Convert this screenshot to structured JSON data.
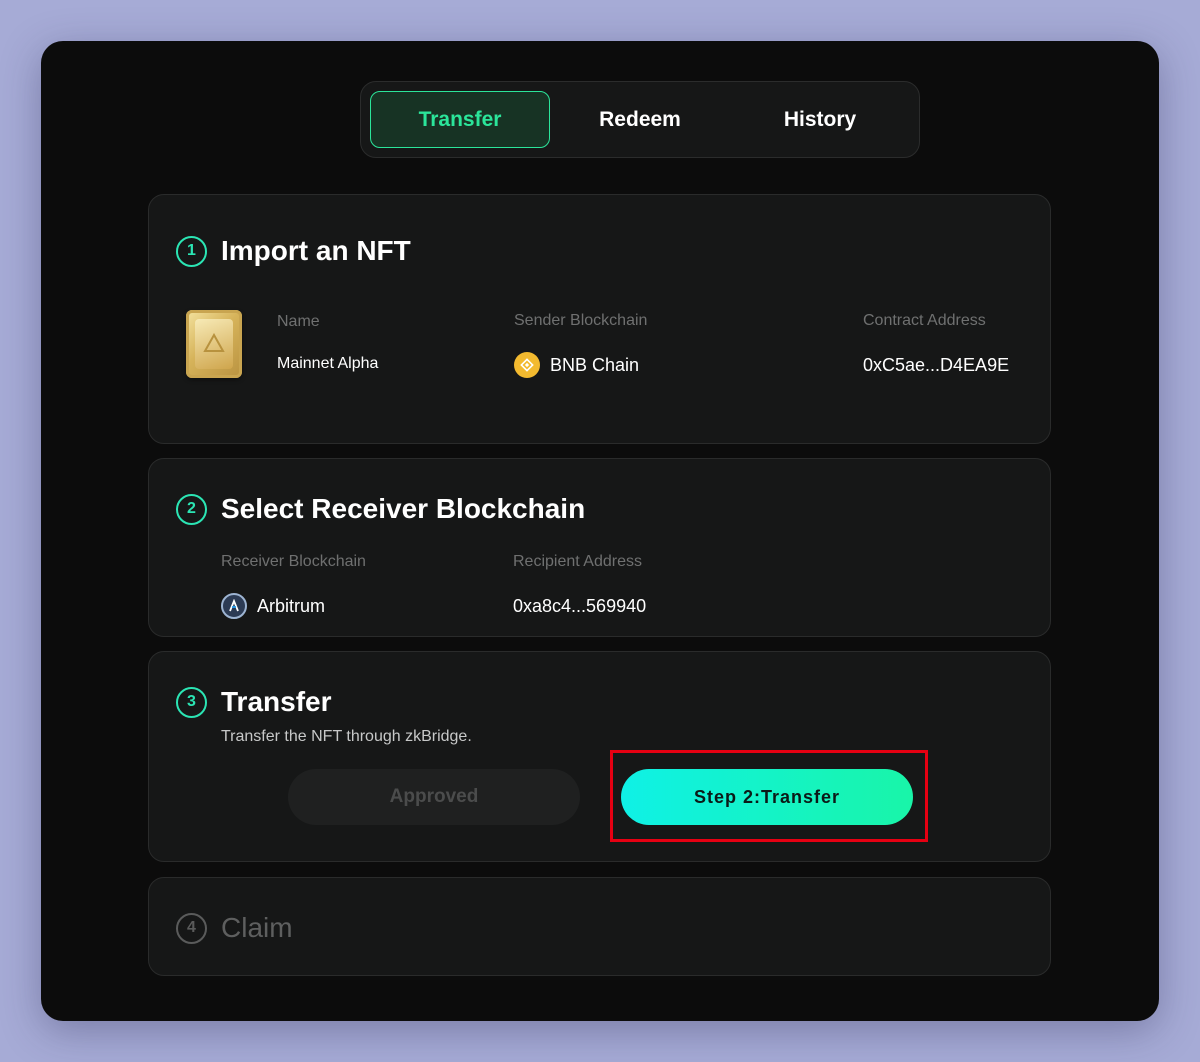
{
  "tabs": [
    {
      "label": "Transfer",
      "active": true
    },
    {
      "label": "Redeem",
      "active": false
    },
    {
      "label": "History",
      "active": false
    }
  ],
  "step1": {
    "number": "1",
    "title": "Import an NFT",
    "name_label": "Name",
    "name_value": "Mainnet Alpha",
    "sender_label": "Sender Blockchain",
    "sender_value": "BNB Chain",
    "sender_icon": "bnb-chain-icon",
    "contract_label": "Contract Address",
    "contract_value": "0xC5ae...D4EA9E"
  },
  "step2": {
    "number": "2",
    "title": "Select Receiver Blockchain",
    "receiver_label": "Receiver Blockchain",
    "receiver_value": "Arbitrum",
    "receiver_icon": "arbitrum-icon",
    "recipient_label": "Recipient Address",
    "recipient_value": "0xa8c4...569940"
  },
  "step3": {
    "number": "3",
    "title": "Transfer",
    "description": "Transfer the NFT through zkBridge.",
    "approved_label": "Approved",
    "transfer_label": "Step 2:Transfer"
  },
  "step4": {
    "number": "4",
    "title": "Claim"
  },
  "colors": {
    "accent": "#2be59a",
    "highlight": "#e60012",
    "bnb": "#f3ba2f"
  }
}
